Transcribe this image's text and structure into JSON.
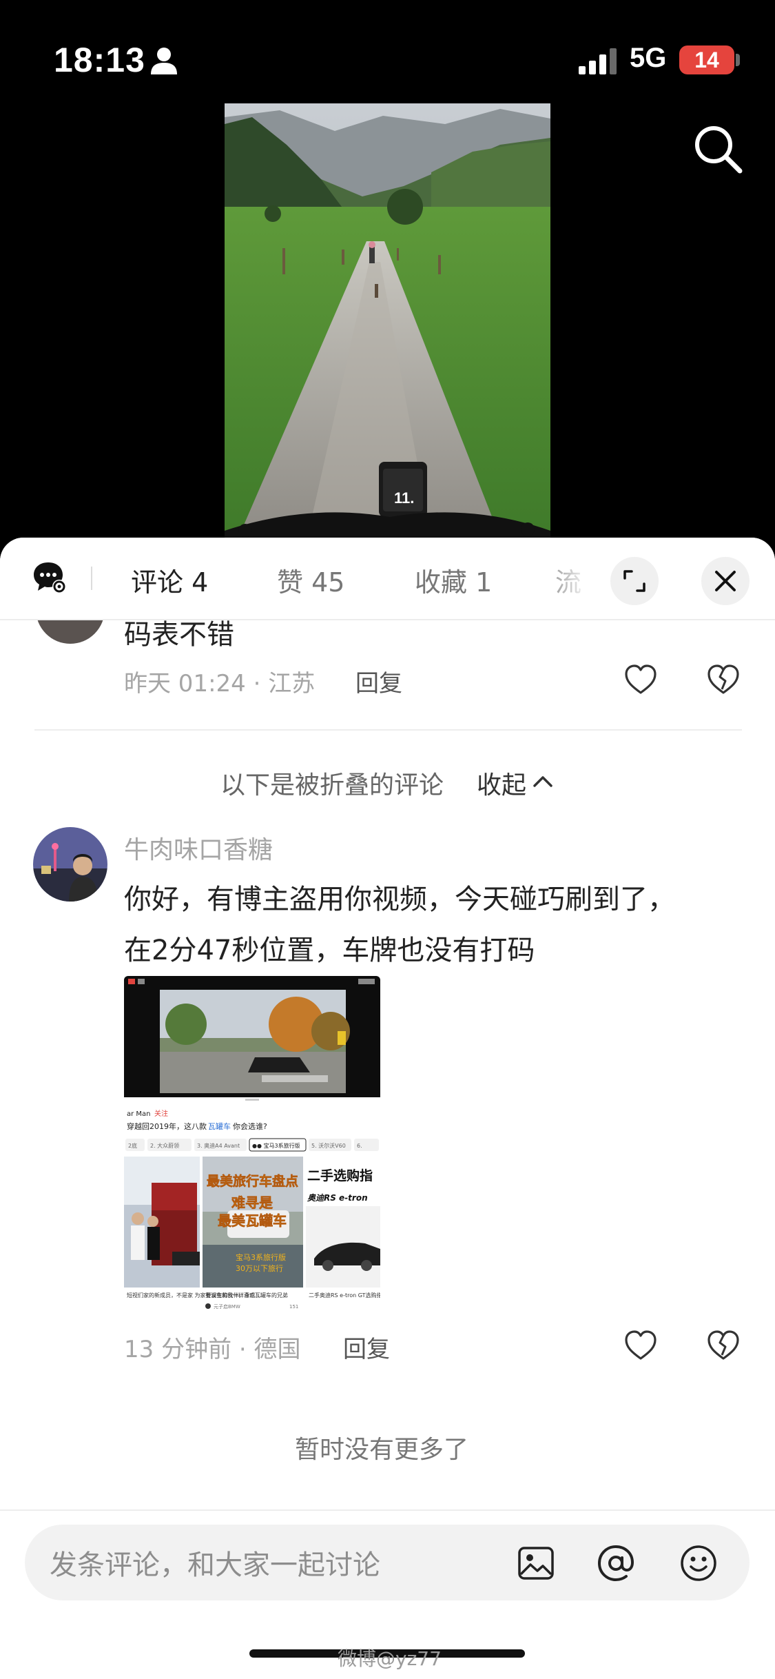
{
  "status_bar": {
    "time": "18:13",
    "network": "5G",
    "battery": "14"
  },
  "tabs": [
    {
      "label": "评论 4"
    },
    {
      "label": "赞 45"
    },
    {
      "label": "收藏 1"
    },
    {
      "label": "流"
    }
  ],
  "comment1": {
    "text": "码表不错",
    "meta": "昨天 01:24 · 江苏",
    "reply": "回复"
  },
  "folded": {
    "label": "以下是被折叠的评论",
    "toggle": "收起"
  },
  "comment2": {
    "username": "牛肉味口香糖",
    "line1": "你好，有博主盗用你视频，今天碰巧刷到了，",
    "line2": "在2分47秒位置，车牌也没有打码",
    "meta": "13 分钟前 · 德国",
    "reply": "回复",
    "image": {
      "header": "ar Man",
      "follow": "关注",
      "headline_a": "穿越回2019年，这八款",
      "headline_b": "瓦罐车",
      "headline_c": "你会选谁?",
      "chips": [
        "2底",
        "2. 大众蔚领",
        "3. 奥迪A4 Avant",
        "●● 宝马3系旅行版",
        "5. 沃尔沃V60",
        "6."
      ],
      "card2_title1": "最美旅行车盘点",
      "card2_title2": "难寻是",
      "card2_title3": "最美瓦罐车",
      "card2_tag1": "宝马3系旅行版",
      "card2_tag2": "30万以下旅行",
      "card3_title": "二手选购指",
      "card3_sub": "奥迪RS e-tron",
      "card1_caption": "短视们家的新成员，不是家\n为家要误生的伙伴，今后…",
      "card2_caption": "有没有和我一样喜欢瓦罐车的兄弟",
      "card2_author": "元子启BMW",
      "card2_likes": "151",
      "card3_caption": "二手奥迪RS e-tron GT选购指\n被低估的好车!"
    }
  },
  "footer_note": "暂时没有更多了",
  "input": {
    "placeholder": "发条评论，和大家一起讨论"
  },
  "watermark": "微博@yz77"
}
